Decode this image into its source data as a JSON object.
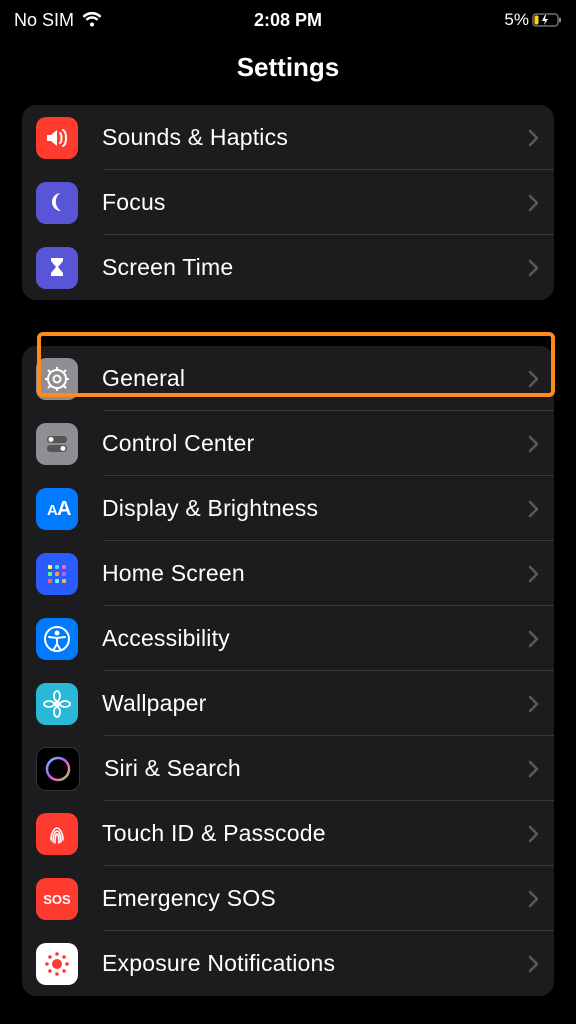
{
  "status": {
    "carrier": "No SIM",
    "time": "2:08 PM",
    "battery_pct": "5%"
  },
  "title": "Settings",
  "group1": [
    {
      "label": "Sounds & Haptics",
      "icon": "speaker-icon",
      "bg": "bg-red"
    },
    {
      "label": "Focus",
      "icon": "moon-icon",
      "bg": "bg-indigo"
    },
    {
      "label": "Screen Time",
      "icon": "hourglass-icon",
      "bg": "bg-indigo"
    }
  ],
  "group2": [
    {
      "label": "General",
      "icon": "gear-icon",
      "bg": "bg-gray",
      "highlighted": true
    },
    {
      "label": "Control Center",
      "icon": "toggles-icon",
      "bg": "bg-gray"
    },
    {
      "label": "Display & Brightness",
      "icon": "text-size-icon",
      "bg": "bg-blue"
    },
    {
      "label": "Home Screen",
      "icon": "grid-icon",
      "bg": "bg-icons"
    },
    {
      "label": "Accessibility",
      "icon": "accessibility-icon",
      "bg": "bg-blue"
    },
    {
      "label": "Wallpaper",
      "icon": "flower-icon",
      "bg": "bg-cyan"
    },
    {
      "label": "Siri & Search",
      "icon": "siri-icon",
      "bg": "bg-black"
    },
    {
      "label": "Touch ID & Passcode",
      "icon": "fingerprint-icon",
      "bg": "bg-red"
    },
    {
      "label": "Emergency SOS",
      "icon": "sos-icon",
      "bg": "bg-orange"
    },
    {
      "label": "Exposure Notifications",
      "icon": "exposure-icon",
      "bg": "bg-white"
    }
  ]
}
